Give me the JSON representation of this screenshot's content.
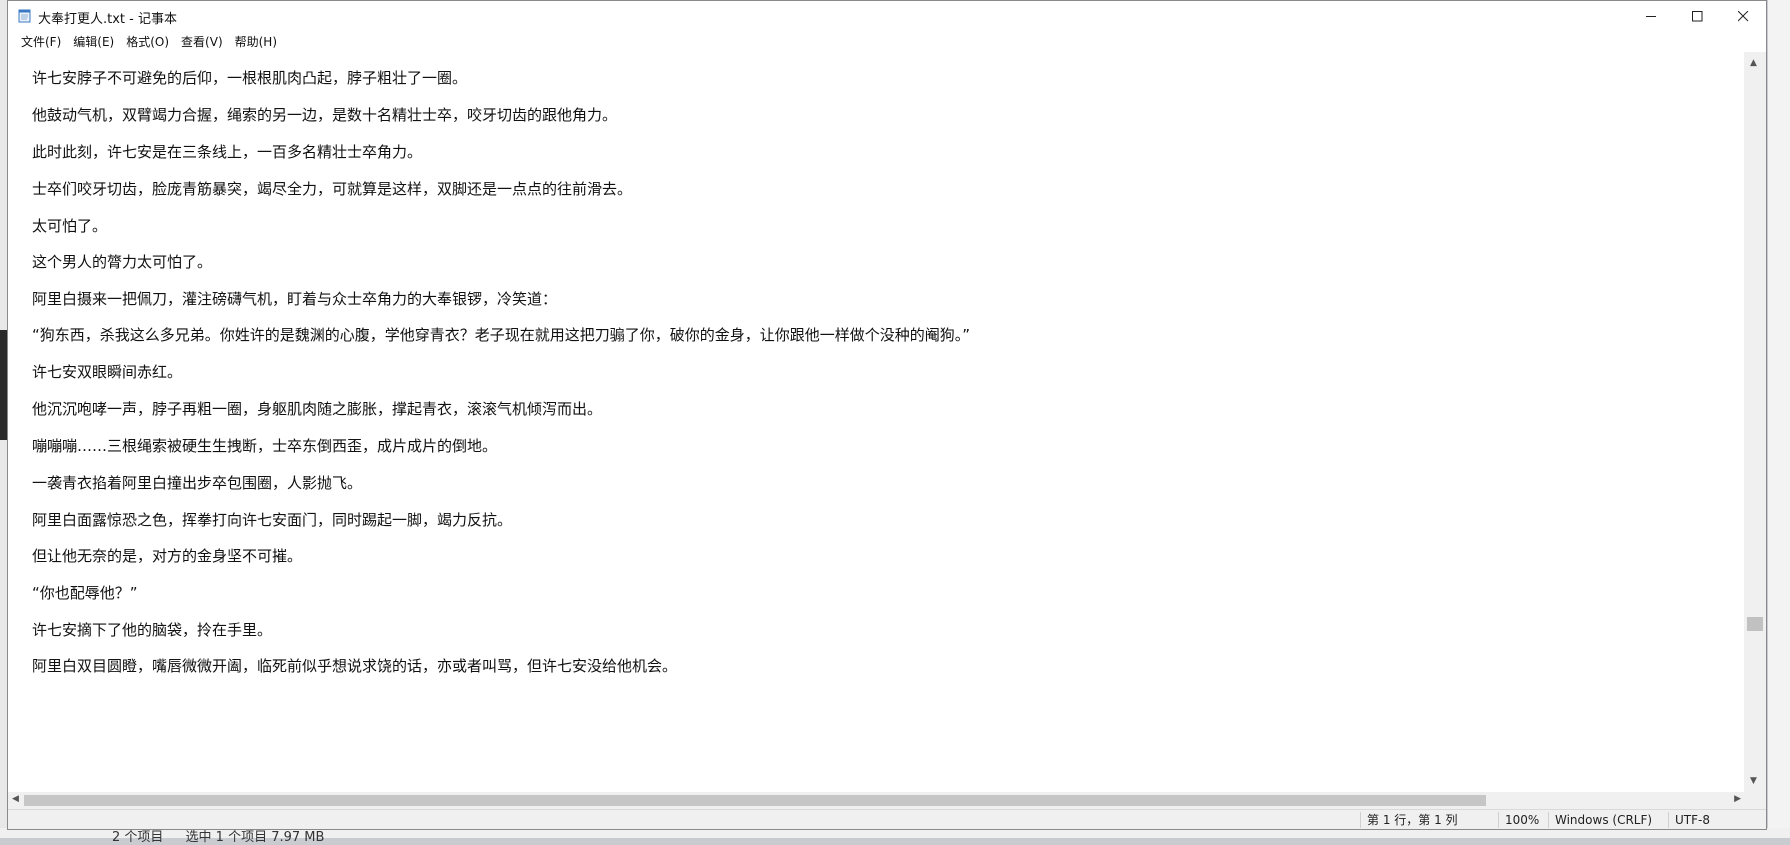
{
  "window": {
    "title": "大奉打更人.txt - 记事本"
  },
  "menu": [
    "文件(F)",
    "编辑(E)",
    "格式(O)",
    "查看(V)",
    "帮助(H)"
  ],
  "lines": [
    "许七安脖子不可避免的后仰，一根根肌肉凸起，脖子粗壮了一圈。",
    "他鼓动气机，双臂竭力合握，绳索的另一边，是数十名精壮士卒，咬牙切齿的跟他角力。",
    "此时此刻，许七安是在三条线上，一百多名精壮士卒角力。",
    "士卒们咬牙切齿，脸庞青筋暴突，竭尽全力，可就算是这样，双脚还是一点点的往前滑去。",
    "太可怕了。",
    "这个男人的膂力太可怕了。",
    "阿里白摄来一把佩刀，灌注磅礴气机，盯着与众士卒角力的大奉银锣，冷笑道：",
    "“狗东西，杀我这么多兄弟。你姓许的是魏渊的心腹，学他穿青衣？老子现在就用这把刀骟了你，破你的金身，让你跟他一样做个没种的阉狗。”",
    "许七安双眼瞬间赤红。",
    "他沉沉咆哮一声，脖子再粗一圈，身躯肌肉随之膨胀，撑起青衣，滚滚气机倾泻而出。",
    "嘣嘣嘣……三根绳索被硬生生拽断，士卒东倒西歪，成片成片的倒地。",
    "一袭青衣掐着阿里白撞出步卒包围圈，人影抛飞。",
    "阿里白面露惊恐之色，挥拳打向许七安面门，同时踢起一脚，竭力反抗。",
    "但让他无奈的是，对方的金身坚不可摧。",
    " “你也配辱他？”",
    "许七安摘下了他的脑袋，拎在手里。",
    "阿里白双目圆瞪，嘴唇微微开阖，临死前似乎想说求饶的话，亦或者叫骂，但许七安没给他机会。"
  ],
  "status": {
    "position": "第 1 行，第 1 列",
    "zoom": "100%",
    "line_ending": "Windows (CRLF)",
    "encoding": "UTF-8"
  },
  "explorer_status": [
    "2 个项目",
    "选中 1 个项目  7.97 MB"
  ]
}
